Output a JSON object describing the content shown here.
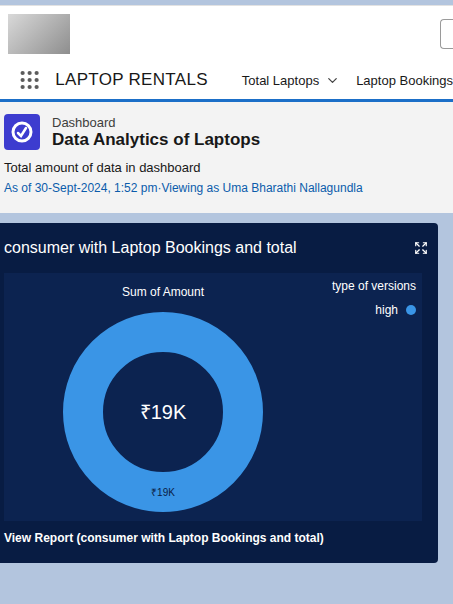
{
  "app": {
    "name": "LAPTOP RENTALS"
  },
  "nav": {
    "tabs": [
      {
        "label": "Total Laptops",
        "selected": false,
        "has_menu": true
      },
      {
        "label": "Laptop Bookings",
        "selected": false,
        "has_menu": false
      }
    ]
  },
  "dashboard": {
    "type": "Dashboard",
    "title": "Data Analytics of Laptops",
    "description": "Total amount of data in dashboard",
    "meta": "As of 30-Sept-2024, 1:52 pm·Viewing as Uma Bharathi Nallagundla"
  },
  "chart": {
    "title": "consumer with Laptop Bookings and total",
    "subtitle": "Sum of Amount",
    "legend_title": "type of versions",
    "series": [
      {
        "label": "high",
        "color": "#3a95e6",
        "values": [
          19000
        ],
        "slice_label": "₹19K"
      }
    ],
    "center_label": "₹19K",
    "footer": "View Report (consumer with Laptop Bookings and total)"
  }
}
